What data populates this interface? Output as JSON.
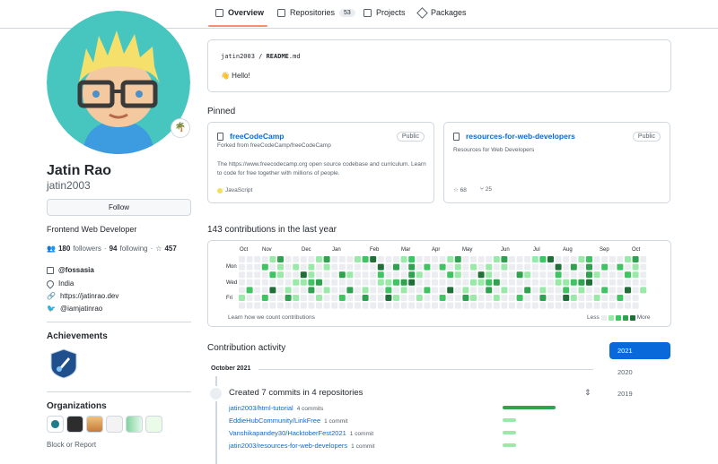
{
  "tabs": [
    {
      "label": "Overview",
      "icon": "book-icon",
      "active": true
    },
    {
      "label": "Repositories",
      "icon": "repo-icon",
      "count": "53"
    },
    {
      "label": "Projects",
      "icon": "project-icon"
    },
    {
      "label": "Packages",
      "icon": "package-icon"
    }
  ],
  "profile": {
    "status_emoji": "🌴",
    "name": "Jatin Rao",
    "login": "jatin2003",
    "follow_label": "Follow",
    "bio": "Frontend Web Developer",
    "followers_count": "180",
    "followers_label": "followers",
    "following_count": "94",
    "following_label": "following",
    "stars_count": "457",
    "org": "@fossasia",
    "location": "India",
    "website": "https://jatinrao.dev",
    "twitter": "@iamjatinrao"
  },
  "sidebar": {
    "achievements_title": "Achievements",
    "organizations_title": "Organizations",
    "block_label": "Block or Report"
  },
  "readme": {
    "owner": "jatin2003",
    "sep": " / ",
    "file": "README",
    "ext": ".md",
    "hello": "👋 Hello!"
  },
  "pinned": {
    "title": "Pinned",
    "items": [
      {
        "name": "freeCodeCamp",
        "visibility": "Public",
        "forked": "Forked from freeCodeCamp/freeCodeCamp",
        "description": "The https://www.freecodecamp.org open source codebase and curriculum. Learn to code for free together with millions of people.",
        "language": "JavaScript",
        "language_color": "#f1e05a"
      },
      {
        "name": "resources-for-web-developers",
        "visibility": "Public",
        "description": "Resources for Web Developers",
        "stars": "68",
        "forks": "25"
      }
    ]
  },
  "contributions": {
    "title": "143 contributions in the last year",
    "months": [
      "Oct",
      "Nov",
      "Dec",
      "Jan",
      "Feb",
      "Mar",
      "Apr",
      "May",
      "Jun",
      "Jul",
      "Aug",
      "Sep",
      "Oct"
    ],
    "days": [
      "Mon",
      "Wed",
      "Fri"
    ],
    "learn": "Learn how we count contributions",
    "less": "Less",
    "more": "More",
    "colors": [
      "#ebedf0",
      "#9be9a8",
      "#40c463",
      "#30a14e",
      "#216e39"
    ]
  },
  "activity": {
    "title": "Contribution activity",
    "month": "October 2021",
    "years": [
      "2021",
      "2020",
      "2019"
    ],
    "summary": "Created 7 commits in 4 repositories",
    "repos": [
      {
        "name": "jatin2003/html-tutorial",
        "commits": "4 commits",
        "share": 1.0
      },
      {
        "name": "EddieHubCommunity/LinkFree",
        "commits": "1 commit",
        "share": 0.25
      },
      {
        "name": "Vanshikapandey30/HacktoberFest2021",
        "commits": "1 commit",
        "share": 0.25
      },
      {
        "name": "jatin2003/resources-for-web-developers",
        "commits": "1 commit",
        "share": 0.25
      }
    ]
  }
}
